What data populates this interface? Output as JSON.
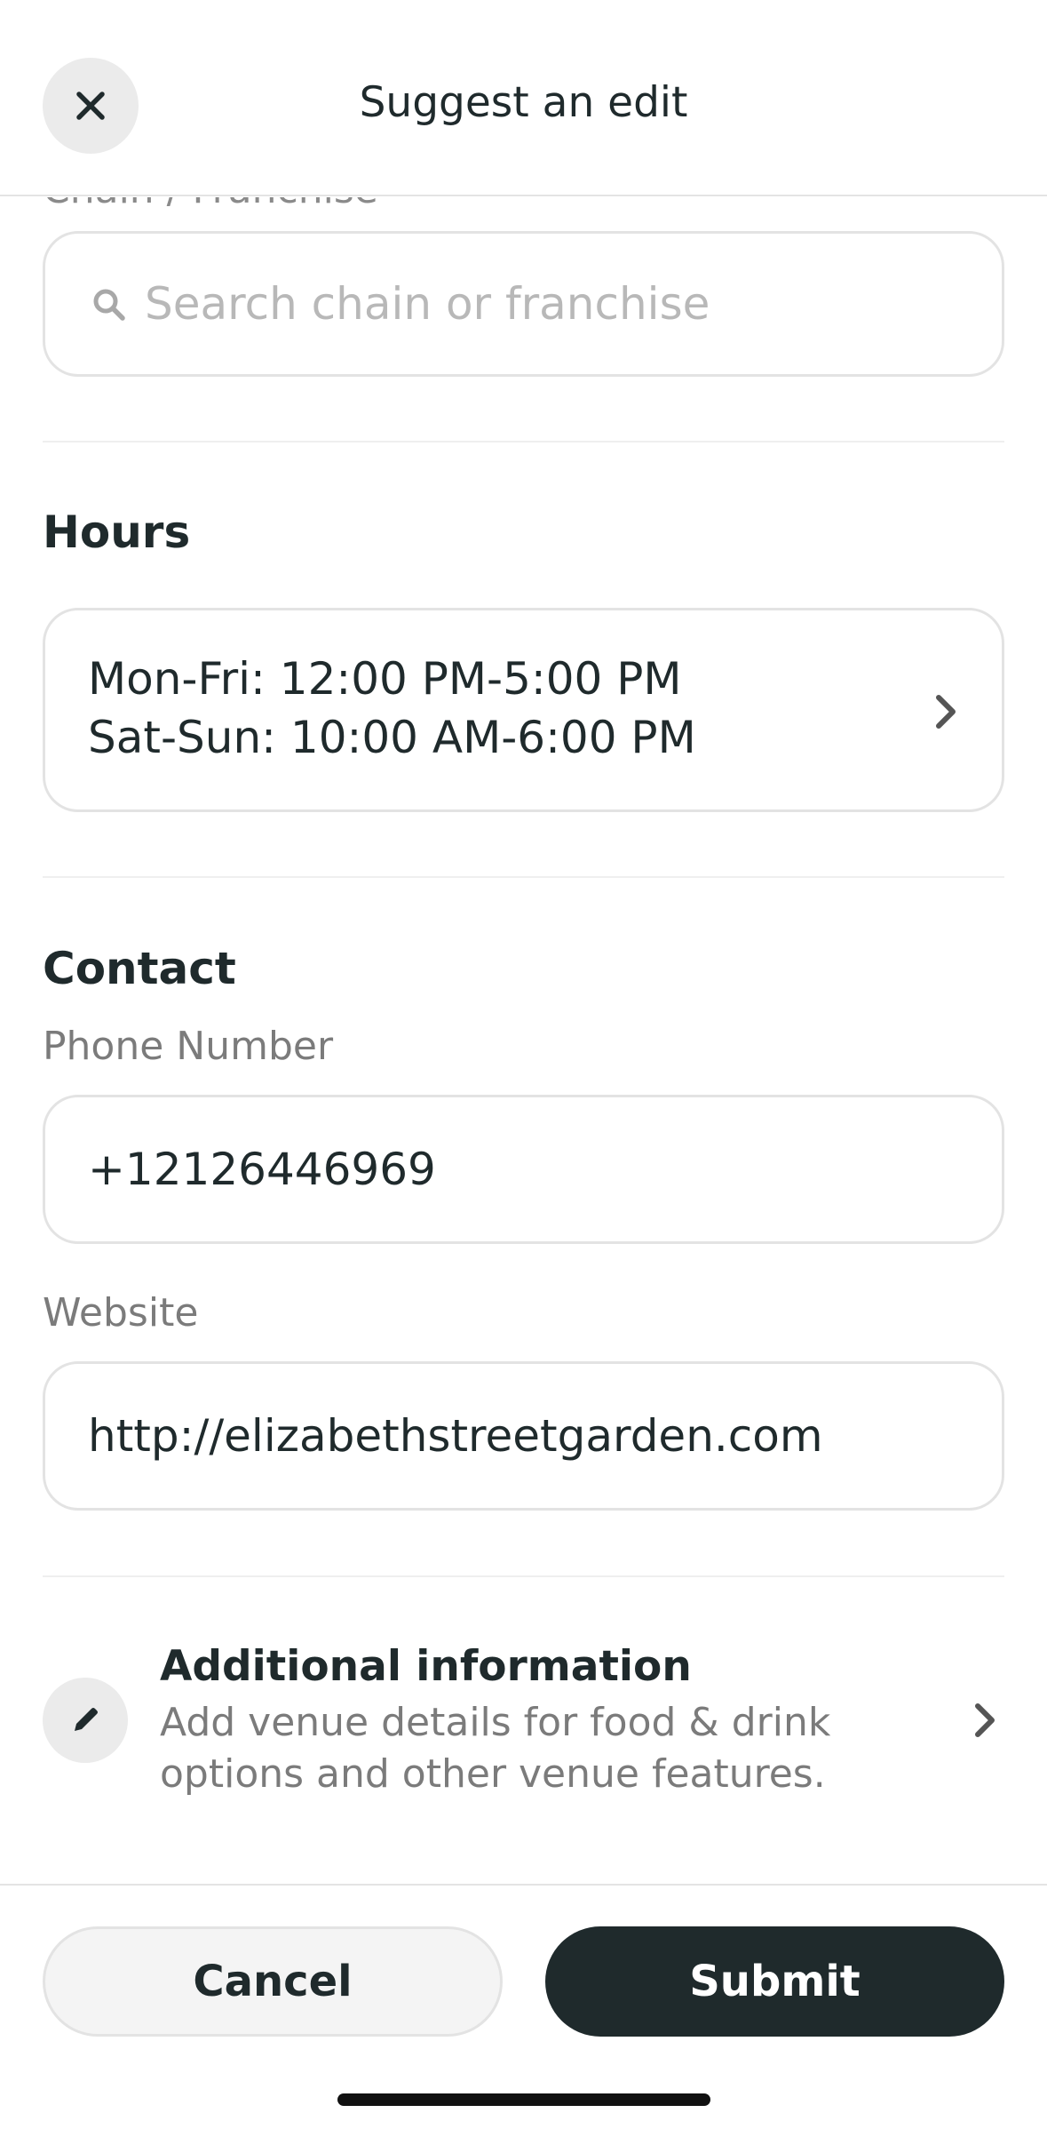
{
  "header": {
    "title": "Suggest an edit",
    "close_icon": "close-icon"
  },
  "chain": {
    "search_placeholder": "Search chain or franchise",
    "search_icon": "search-icon"
  },
  "hours": {
    "title": "Hours",
    "lines": [
      "Mon-Fri: 12:00 PM-5:00 PM",
      "Sat-Sun: 10:00 AM-6:00 PM"
    ],
    "chevron_icon": "chevron-right-icon"
  },
  "contact": {
    "title": "Contact",
    "phone_label": "Phone Number",
    "phone_value": "+12126446969",
    "website_label": "Website",
    "website_value": "http://elizabethstreetgarden.com"
  },
  "additional": {
    "title": "Additional information",
    "description": "Add venue details for food & drink options and other venue features.",
    "icon": "pencil-icon",
    "chevron_icon": "chevron-right-icon"
  },
  "footer": {
    "cancel_label": "Cancel",
    "submit_label": "Submit"
  },
  "colors": {
    "primary_dark": "#1f2a2c",
    "muted_text": "#7b7b7b",
    "placeholder": "#b8b8b8",
    "border": "#e3e3e3"
  }
}
